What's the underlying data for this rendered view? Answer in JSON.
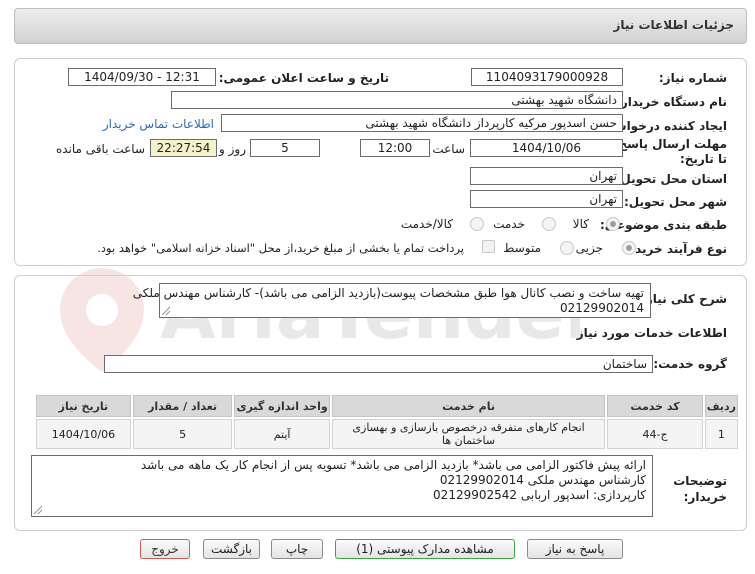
{
  "header": {
    "title": "جزئیات اطلاعات نیاز"
  },
  "form": {
    "need_number": {
      "label": "شماره نیاز:",
      "value": "1104093179000928"
    },
    "announce_datetime": {
      "label": "تاریخ و ساعت اعلان عمومی:",
      "value": "1404/09/30 - 12:31"
    },
    "buyer_org": {
      "label": "نام دستگاه خریدار:",
      "value": "دانشگاه شهید بهشتی"
    },
    "requester": {
      "label": "ایجاد کننده درخواست:",
      "value": "حسن اسدپور مرکیه کارپرداز دانشگاه شهید بهشتی",
      "contact_link": "اطلاعات تماس خریدار"
    },
    "deadline": {
      "label": "مهلت ارسال پاسخ: تا تاریخ:",
      "date": "1404/10/06",
      "time_label": "ساعت",
      "time": "12:00",
      "days": "5",
      "days_label": "روز و",
      "remaining": "22:27:54",
      "remaining_label": "ساعت باقی مانده"
    },
    "province": {
      "label": "استان محل تحویل:",
      "value": "تهران"
    },
    "city": {
      "label": "شهر محل تحویل:",
      "value": "تهران"
    },
    "category": {
      "label": "طبقه بندی موضوعی:",
      "options": [
        "کالا",
        "خدمت",
        "کالا/خدمت"
      ],
      "selected": "کالا"
    },
    "process": {
      "label": "نوع فرآیند خرید :",
      "options": [
        "جزیی",
        "متوسط"
      ],
      "selected": "جزیی",
      "payment_note": "پرداخت تمام یا بخشی از مبلغ خرید،از محل \"اسناد خزانه اسلامی\" خواهد بود."
    }
  },
  "description": {
    "label": "شرح کلی نیاز:",
    "line1": "تهیه ساخت و نصب کانال هوا طبق مشخصات پیوست(بازدید الزامی می باشد)- کارشناس مهندس ملکی",
    "line2": "02129902014"
  },
  "services": {
    "section_title": "اطلاعات خدمات مورد نیاز",
    "group_label": "گروه خدمت:",
    "group_value": "ساختمان",
    "columns": [
      "ردیف",
      "کد خدمت",
      "نام خدمت",
      "واحد اندازه گیری",
      "تعداد / مقدار",
      "تاریخ نیاز"
    ],
    "rows": [
      {
        "index": "1",
        "code": "ج-44",
        "name": "انجام کارهای متفرقه درخصوص بازسازی و بهسازی ساختمان ها",
        "unit": "آیتم",
        "qty": "5",
        "date": "1404/10/06"
      }
    ]
  },
  "buyer_notes": {
    "label": "توضیحات خریدار:",
    "line1": "ارائه پیش فاکتور الزامی می باشد* بازدید الزامی می باشد* تسویه پس از انجام کار یک ماهه می باشد",
    "line2": "کارشناس مهندس ملکی 02129902014",
    "line3": "کارپردازی: اسدپور اربابی 02129902542"
  },
  "buttons": {
    "reply": "پاسخ به نیاز",
    "docs": "مشاهده مدارک پیوستی (1)",
    "print": "چاپ",
    "back": "بازگشت",
    "exit": "خروج"
  },
  "watermark": {
    "text": "AriaTender.net"
  },
  "colors": {
    "accent_link": "#2a6db5",
    "timer_bg": "#f5f2c9",
    "green_border": "#3fa33f",
    "red_border": "#d45a5a"
  }
}
